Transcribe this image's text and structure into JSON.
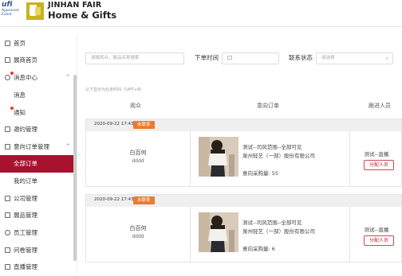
{
  "header": {
    "ufi_logo": "ufi",
    "ufi_sub1": "Approved",
    "ufi_sub2": "Event",
    "brand_line1": "JINHAN FAIR",
    "brand_line2": "Home & Gifts"
  },
  "sidebar": {
    "items": [
      {
        "label": "首页",
        "icon": "home-icon"
      },
      {
        "label": "展商首页",
        "icon": "store-icon"
      },
      {
        "label": "消息中心",
        "icon": "message-icon"
      },
      {
        "label": "消息"
      },
      {
        "label": "通知"
      },
      {
        "label": "邀约管理",
        "icon": "mail-icon"
      },
      {
        "label": "意向订单管理",
        "icon": "cart-icon"
      },
      {
        "label": "全部订单"
      },
      {
        "label": "我的订单"
      },
      {
        "label": "公司管理",
        "icon": "building-icon"
      },
      {
        "label": "展品管理",
        "icon": "box-icon"
      },
      {
        "label": "员工管理",
        "icon": "user-icon"
      },
      {
        "label": "问卷管理",
        "icon": "survey-icon"
      },
      {
        "label": "直播管理",
        "icon": "live-icon"
      }
    ]
  },
  "filters": {
    "search_placeholder": "请输观众、展品名称搜索",
    "time_label": "下单时间",
    "status_label": "联系状态",
    "status_placeholder": "请选择"
  },
  "timezone_note": "以下显示为北京时间（UMT+8）",
  "table": {
    "col_audience": "观众",
    "col_order": "意向订单",
    "col_staff": "跟进人员"
  },
  "orders": [
    {
      "time": "2020-09-22 17:43",
      "status": "未联系",
      "visitor_name": "白百何",
      "visitor_company": "dddd",
      "product": "测试--司风范围--全部可见",
      "company": "泉州轻艺（一部）股份有限公司",
      "quantity": "意向采购量: 55",
      "staff": "测试--直播",
      "assign_label": "分配人员"
    },
    {
      "time": "2020-09-22 17:43",
      "status": "未联系",
      "visitor_name": "白百何",
      "visitor_company": "dddd",
      "product": "测试--司风范围--全部可见",
      "company": "泉州轻艺（一部）股份有限公司",
      "quantity": "意向采购量: 6",
      "staff": "测试--直播",
      "assign_label": "分配人员"
    }
  ],
  "colors": {
    "accent": "#a8122f",
    "status_badge": "#e87d2e"
  }
}
